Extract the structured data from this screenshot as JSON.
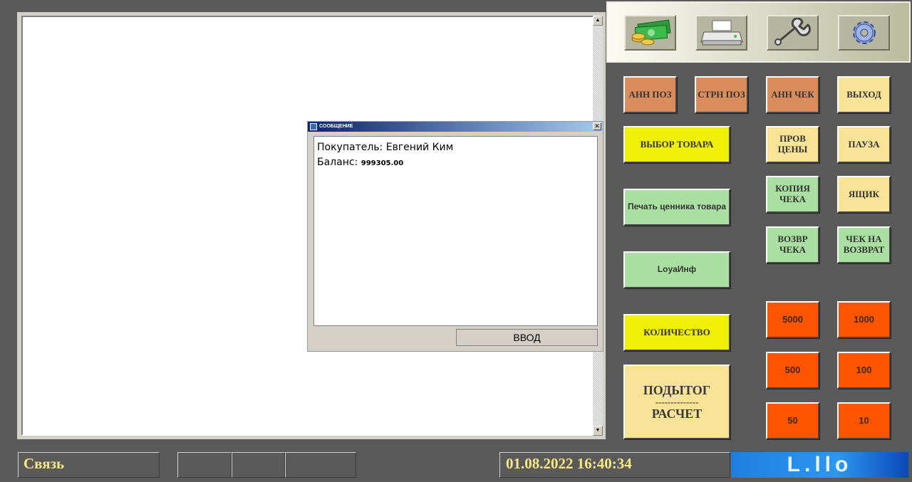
{
  "dialog": {
    "title": "СООБЩЕНИЕ",
    "close": "✕",
    "customer_label": "Покупатель:",
    "customer_name": "Евгений  Ким",
    "balance_label": "Баланс:",
    "balance_value": "999305.00",
    "ok_label": "ВВОД"
  },
  "scroll": {
    "up": "▲",
    "down": "▼"
  },
  "toolbar": {
    "items": [
      {
        "name": "money-icon"
      },
      {
        "name": "printer-icon"
      },
      {
        "name": "wrench-icon"
      },
      {
        "name": "gear-icon"
      }
    ]
  },
  "buttons": {
    "ann_poz": "АНН ПОЗ",
    "strn_poz": "СТРН ПОЗ",
    "ann_chek": "АНН ЧЕК",
    "vykhod": "ВЫХОД",
    "vybor_tovara": "ВЫБОР ТОВАРА",
    "prov_ceny_1": "ПРОВ",
    "prov_ceny_2": "ЦЕНЫ",
    "pauza": "ПАУЗА",
    "pechat_cennika": "Печать ценника товара",
    "kopiya_cheka_1": "КОПИЯ",
    "kopiya_cheka_2": "ЧЕКА",
    "yashchik": "ЯЩИК",
    "vozvr_cheka_1": "ВОЗВР",
    "vozvr_cheka_2": "ЧЕКА",
    "chek_na_vozvrat_1": "ЧЕК НА",
    "chek_na_vozvrat_2": "ВОЗВРАТ",
    "loyainf": "LoyaИнф",
    "kolichestvo": "КОЛИЧЕСТВО",
    "podytog": "ПОДЫТОГ",
    "podytog_sep": "--------------",
    "raschet": "РАСЧЕТ",
    "n5000": "5000",
    "n1000": "1000",
    "n500": "500",
    "n100": "100",
    "n50": "50",
    "n10": "10"
  },
  "status": {
    "connection": "Связь",
    "datetime": "01.08.2022 16:40:34",
    "logo": "L.llo"
  }
}
